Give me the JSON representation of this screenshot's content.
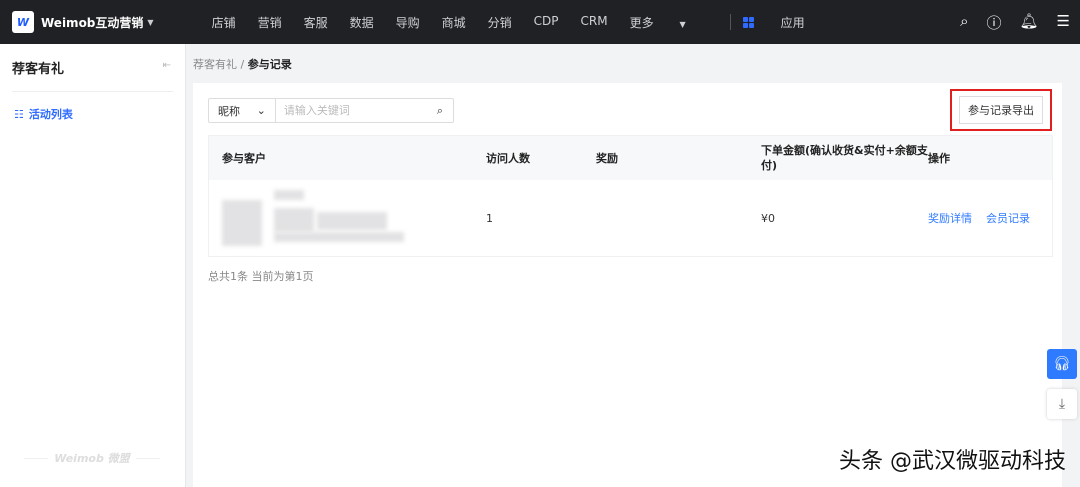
{
  "topbar": {
    "brand": "Weimob互动营销",
    "nav": [
      "店铺",
      "营销",
      "客服",
      "数据",
      "导购",
      "商城",
      "分销",
      "CDP",
      "CRM",
      "更多"
    ],
    "app": "应用"
  },
  "sidebar": {
    "title": "荐客有礼",
    "items": [
      {
        "label": "活动列表"
      }
    ],
    "footer_logo": "Weimob 微盟"
  },
  "breadcrumb": {
    "parent": "荐客有礼",
    "sep": "/",
    "current": "参与记录"
  },
  "search": {
    "field": "昵称",
    "placeholder": "请输入关键词",
    "value": ""
  },
  "export_label": "参与记录导出",
  "table": {
    "headers": [
      "参与客户",
      "访问人数",
      "奖励",
      "下单金额(确认收货&实付+余额支付)",
      "操作"
    ],
    "rows": [
      {
        "customer": "",
        "visits": "1",
        "reward": "",
        "amount": "¥0",
        "actions": [
          "奖励详情",
          "会员记录"
        ]
      }
    ]
  },
  "pagination": "总共1条 当前为第1页",
  "watermark": "头条 @武汉微驱动科技"
}
